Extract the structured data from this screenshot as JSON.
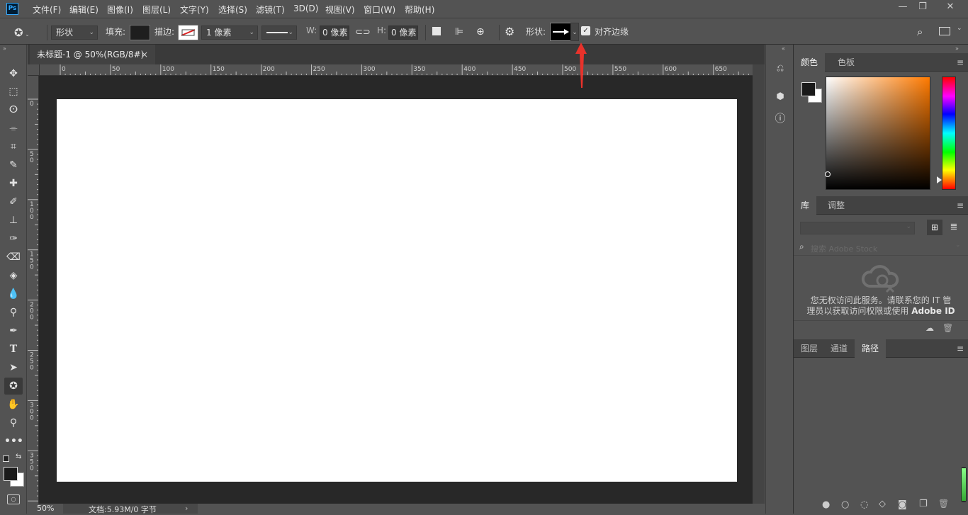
{
  "app": {
    "logo": "Ps"
  },
  "menu": [
    "文件(F)",
    "编辑(E)",
    "图像(I)",
    "图层(L)",
    "文字(Y)",
    "选择(S)",
    "滤镜(T)",
    "3D(D)",
    "视图(V)",
    "窗口(W)",
    "帮助(H)"
  ],
  "window_controls": {
    "minimize": "—",
    "restore": "❐",
    "close": "✕"
  },
  "options": {
    "mode": "形状",
    "fill_label": "填充:",
    "stroke_label": "描边:",
    "stroke_width": "1 像素",
    "w_label": "W:",
    "w_value": "0 像素",
    "h_label": "H:",
    "h_value": "0 像素",
    "shape_label": "形状:",
    "align_edges": "对齐边缘",
    "align_checked": true
  },
  "document": {
    "tab_title": "未标题-1 @ 50%(RGB/8#)",
    "tab_close": "×",
    "hruler": [
      "0",
      "50",
      "100",
      "150",
      "200",
      "250",
      "300",
      "350",
      "400",
      "450",
      "500",
      "550",
      "600",
      "650"
    ],
    "vruler": [
      "0",
      "50",
      "100",
      "150",
      "200",
      "250",
      "300",
      "350"
    ],
    "zoom": "50%",
    "doc_info": "文档:5.93M/0 字节",
    "status_arrow": "›"
  },
  "panels": {
    "color": {
      "tabs": [
        "颜色",
        "色板"
      ],
      "active": 0
    },
    "library": {
      "tabs": [
        "库",
        "调整"
      ],
      "active": 0,
      "search_placeholder": "搜索 Adobe Stock",
      "message_line1": "您无权访问此服务。请联系您的 IT 管",
      "message_line2_a": "理员以获取访问权限或使用 ",
      "message_line2_b": "Adobe ID"
    },
    "layers": {
      "tabs": [
        "图层",
        "通道",
        "路径"
      ],
      "active": 2
    }
  },
  "colors": {
    "accent_arrow": "#e8322b",
    "fg_swatch": "#000000",
    "bg_swatch": "#ffffff",
    "hue": "#ff7a00"
  }
}
